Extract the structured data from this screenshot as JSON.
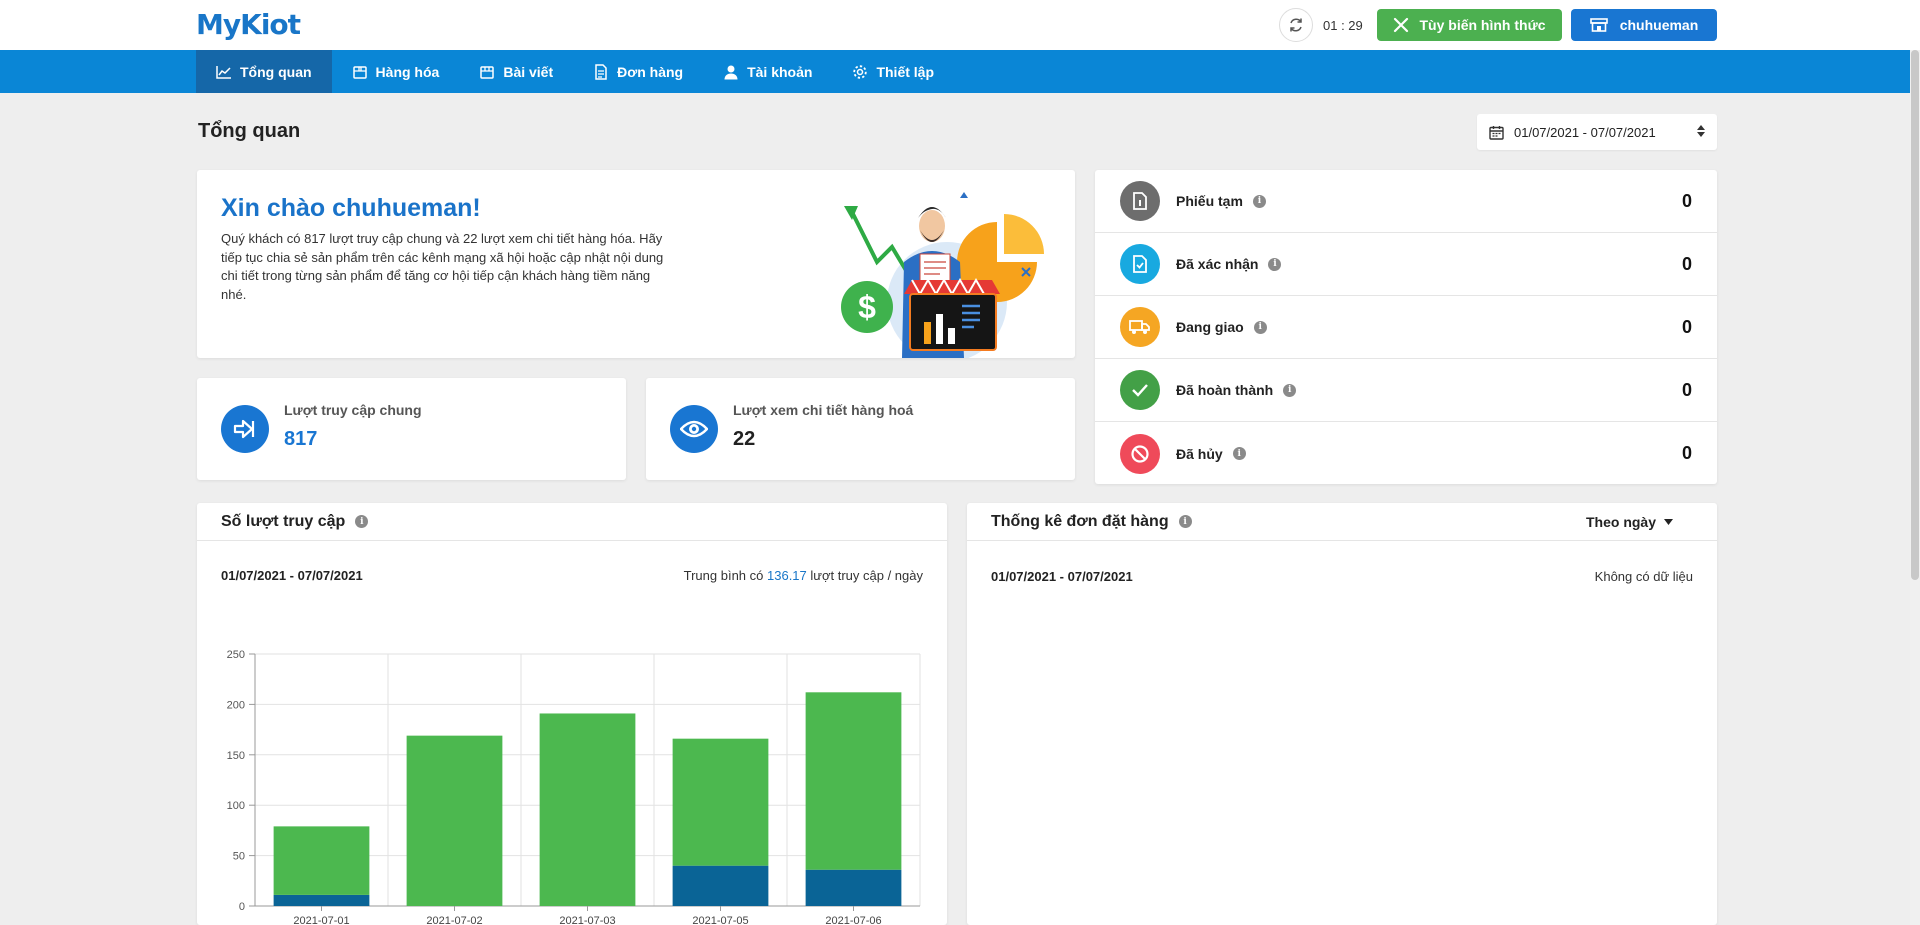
{
  "header": {
    "logo": "MyKiot",
    "timer": "01 : 29",
    "customize_label": "Tùy biến hình thức",
    "user_label": "chuhueman"
  },
  "nav": [
    {
      "label": "Tổng quan",
      "icon": "chart-line-icon"
    },
    {
      "label": "Hàng hóa",
      "icon": "box-icon"
    },
    {
      "label": "Bài viết",
      "icon": "article-icon"
    },
    {
      "label": "Đơn hàng",
      "icon": "document-icon"
    },
    {
      "label": "Tài khoản",
      "icon": "user-icon"
    },
    {
      "label": "Thiết lập",
      "icon": "gear-icon"
    }
  ],
  "page": {
    "title": "Tổng quan",
    "date_range": "01/07/2021 - 07/07/2021"
  },
  "welcome": {
    "title": "Xin chào chuhueman!",
    "text": "Quý khách có 817 lượt truy cập chung và 22 lượt xem chi tiết hàng hóa. Hãy tiếp tục chia sẻ sản phẩm trên các kênh mạng xã hội hoặc cập nhật nội dung chi tiết trong từng sản phẩm để tăng cơ hội tiếp cận khách hàng tiềm năng nhé."
  },
  "stats": [
    {
      "label": "Lượt truy cập chung",
      "value": "817",
      "icon": "enter-icon"
    },
    {
      "label": "Lượt xem chi tiết hàng hoá",
      "value": "22",
      "icon": "eye-icon"
    }
  ],
  "orders": [
    {
      "label": "Phiếu tạm",
      "value": "0",
      "color": "#6d6d6d",
      "icon": "draft-icon"
    },
    {
      "label": "Đã xác nhận",
      "value": "0",
      "color": "#18a9e0",
      "icon": "confirmed-icon"
    },
    {
      "label": "Đang giao",
      "value": "0",
      "color": "#f5a623",
      "icon": "truck-icon"
    },
    {
      "label": "Đã hoàn thành",
      "value": "0",
      "color": "#43a047",
      "icon": "check-icon"
    },
    {
      "label": "Đã hủy",
      "value": "0",
      "color": "#ef4a5a",
      "icon": "cancel-icon"
    }
  ],
  "visits": {
    "title": "Số lượt truy cập",
    "range": "01/07/2021 - 07/07/2021",
    "avg_prefix": "Trung bình có",
    "avg_value": "136.17",
    "avg_suffix": "lượt truy cập / ngày"
  },
  "order_stats": {
    "title": "Thống kê đơn đặt hàng",
    "filter": "Theo ngày",
    "range": "01/07/2021 - 07/07/2021",
    "nodata": "Không có dữ liệu"
  },
  "chart_data": {
    "type": "bar",
    "stacked": true,
    "categories": [
      "2021-07-01",
      "2021-07-02",
      "2021-07-03",
      "2021-07-05",
      "2021-07-06"
    ],
    "series": [
      {
        "values": [
          11,
          0,
          0,
          40,
          36
        ],
        "color": "#0a6496"
      },
      {
        "values": [
          68,
          169,
          191,
          126,
          176
        ],
        "color": "#4cb84f"
      }
    ],
    "ylim": [
      0,
      250
    ],
    "yticks": [
      0,
      50,
      100,
      150,
      200,
      250
    ],
    "grid": true
  }
}
